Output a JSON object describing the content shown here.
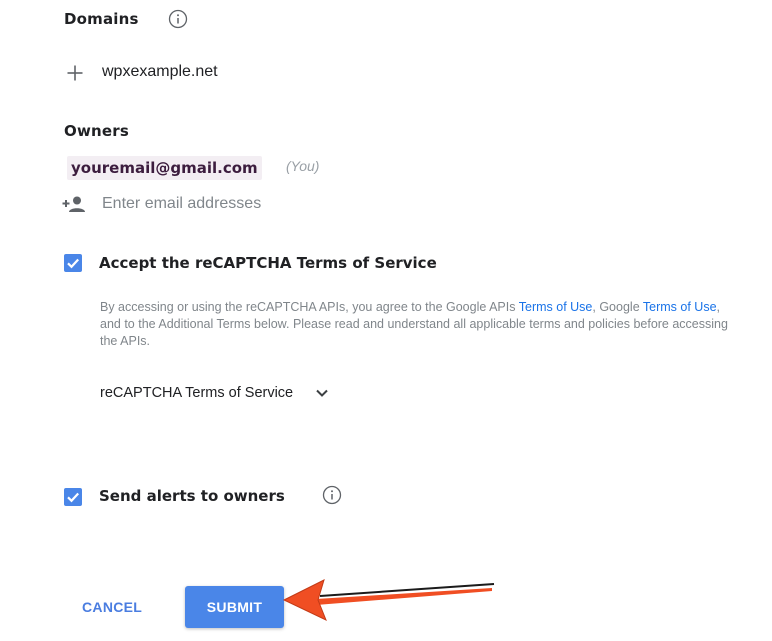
{
  "domains": {
    "title": "Domains",
    "info_icon": "info-circle-icon",
    "add_icon": "plus-icon",
    "items": [
      "wpxexample.net"
    ]
  },
  "owners": {
    "title": "Owners",
    "email": "youremail@gmail.com",
    "you_tag": "(You)",
    "add_icon": "person-add-icon",
    "input_placeholder": "Enter email addresses",
    "input_value": ""
  },
  "terms": {
    "checkbox_checked": true,
    "label": "Accept the reCAPTCHA Terms of Service",
    "text_1": "By accessing or using the reCAPTCHA APIs, you agree to the Google APIs ",
    "link_1": "Terms of Use",
    "text_2": ", Google ",
    "link_2": "Terms of Use",
    "text_3": ", and to the Additional Terms below. Please read and understand all applicable terms and policies before accessing the APIs.",
    "dropdown_label": "reCAPTCHA Terms of Service",
    "dropdown_icon": "chevron-down-icon"
  },
  "alerts": {
    "checkbox_checked": true,
    "label": "Send alerts to owners",
    "info_icon": "info-circle-icon"
  },
  "actions": {
    "cancel_label": "CANCEL",
    "submit_label": "SUBMIT"
  },
  "annotation": {
    "arrow_color": "#f04e23",
    "arrow_icon": "arrow-left-icon"
  },
  "colors": {
    "accent": "#4a86e8",
    "link": "#1a73e8",
    "cancel": "#4a7de0",
    "arrow": "#f04e23"
  }
}
